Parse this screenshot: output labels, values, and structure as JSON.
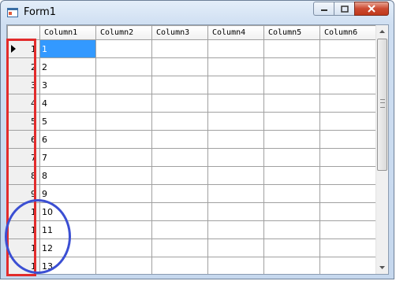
{
  "window": {
    "title": "Form1",
    "icon": "app-window-icon"
  },
  "caption_buttons": {
    "minimize": "minimize-icon",
    "maximize": "maximize-icon",
    "close": "close-icon"
  },
  "grid": {
    "columns": [
      "Column1",
      "Column2",
      "Column3",
      "Column4",
      "Column5",
      "Column6"
    ],
    "rows": [
      {
        "header": "1",
        "value": "1",
        "current": true
      },
      {
        "header": "2",
        "value": "2"
      },
      {
        "header": "3",
        "value": "3"
      },
      {
        "header": "4",
        "value": "4"
      },
      {
        "header": "5",
        "value": "5"
      },
      {
        "header": "6",
        "value": "6"
      },
      {
        "header": "7",
        "value": "7"
      },
      {
        "header": "8",
        "value": "8"
      },
      {
        "header": "9",
        "value": "9"
      },
      {
        "header": "1",
        "value": "10"
      },
      {
        "header": "1",
        "value": "11"
      },
      {
        "header": "1",
        "value": "12"
      },
      {
        "header": "1",
        "value": "13"
      }
    ],
    "selected_cell": {
      "row": 1,
      "column": "Column1"
    }
  },
  "annotations": {
    "box_color": "#e22b2b",
    "ellipse_color": "#3b4fd3"
  }
}
